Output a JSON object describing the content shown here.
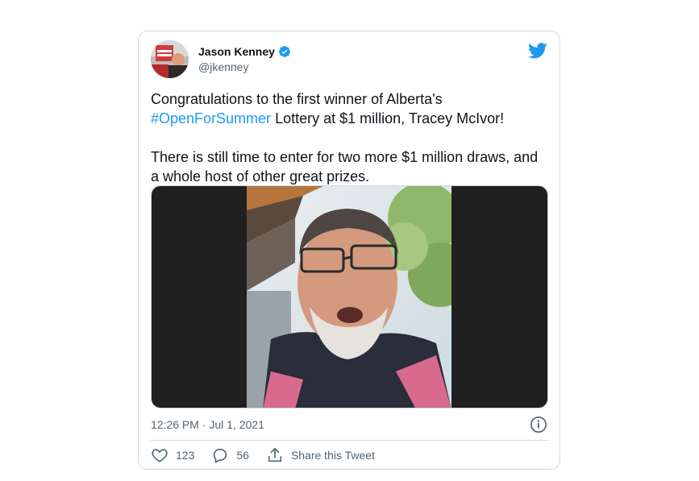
{
  "tweet": {
    "author": {
      "display_name": "Jason Kenney",
      "handle": "@jkenney",
      "verified_icon": "verified-badge-icon",
      "avatar_icon": "profile-avatar"
    },
    "platform_icon": "twitter-bird-icon",
    "text": {
      "line1": "Congratulations to the first winner of Alberta's",
      "hashtag": "#OpenForSummer",
      "line2_rest": " Lottery at $1 million, Tracey McIvor!",
      "paragraph2": "There is still time to enter for two more $1 million draws, and a whole host of other great prizes."
    },
    "timestamp": "12:26 PM · Jul 1, 2021",
    "actions": {
      "like_count": "123",
      "reply_count": "56",
      "share_label": "Share this Tweet"
    },
    "colors": {
      "accent": "#1d9bf0",
      "text": "#0f1419",
      "muted": "#536471",
      "border": "#cfd9de"
    }
  }
}
